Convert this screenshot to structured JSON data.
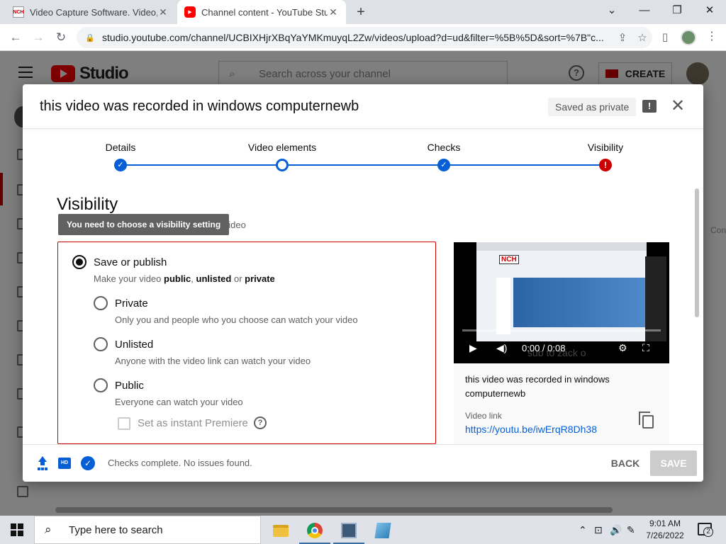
{
  "browser": {
    "tabs": [
      {
        "title": "Video Capture Software. Video, V",
        "favicon": "nch-icon",
        "active": false
      },
      {
        "title": "Channel content - YouTube Studi",
        "favicon": "youtube-icon",
        "active": true
      }
    ],
    "new_tab_glyph": "+",
    "window_controls": {
      "tab_search": "⌄",
      "minimize": "—",
      "restore": "❐",
      "close": "✕"
    },
    "nav": {
      "back": "←",
      "forward": "→",
      "reload": "↻"
    },
    "url": "studio.youtube.com/channel/UCBIXHjrXBqYaYMKmuyqL2Zw/videos/upload?d=ud&filter=%5B%5D&sort=%7B\"c...",
    "url_icons": {
      "share": "⇪",
      "bookmark": "☆"
    },
    "menu_dots": "⋮"
  },
  "studio": {
    "brand": "Studio",
    "search_placeholder": "Search across your channel",
    "help_glyph": "?",
    "create_label": "CREATE",
    "bg_cut_text": "Con"
  },
  "dialog": {
    "title": "this video was recorded in windows computernewb",
    "saved_status": "Saved as private",
    "feedback_glyph": "!",
    "close_glyph": "✕",
    "steps": [
      {
        "label": "Details",
        "state": "complete",
        "glyph": "✓"
      },
      {
        "label": "Video elements",
        "state": "current",
        "glyph": ""
      },
      {
        "label": "Checks",
        "state": "complete",
        "glyph": "✓"
      },
      {
        "label": "Visibility",
        "state": "error",
        "glyph": "!"
      }
    ],
    "visibility": {
      "heading": "Visibility",
      "description_tail": "e your video",
      "tooltip": "You need to choose a visibility setting",
      "save_or_publish": {
        "title": "Save or publish",
        "sub_prefix": "Make your video ",
        "sub_public": "public",
        "sub_comma": ", ",
        "sub_unlisted": "unlisted",
        "sub_or": " or ",
        "sub_private": "private"
      },
      "options": [
        {
          "title": "Private",
          "description": "Only you and people who you choose can watch your video"
        },
        {
          "title": "Unlisted",
          "description": "Anyone with the video link can watch your video"
        },
        {
          "title": "Public",
          "description": "Everyone can watch your video"
        }
      ],
      "premiere_label": "Set as instant Premiere",
      "premiere_help": "?"
    },
    "preview": {
      "time": "0:00 / 0:08",
      "overlay_text": "sub to zack o",
      "screenshot_logo": "NCH",
      "video_title": "this video was recorded in windows computernewb",
      "link_label": "Video link",
      "link_url": "https://youtu.be/iwErqR8Dh38"
    },
    "footer": {
      "hd_badge": "HD",
      "check_glyph": "✓",
      "status": "Checks complete. No issues found.",
      "back_label": "BACK",
      "save_label": "SAVE"
    }
  },
  "taskbar": {
    "search_placeholder": "Type here to search",
    "search_glyph": "⌕",
    "tray_up": "⌃",
    "tray_network": "⊡",
    "tray_volume": "🔊",
    "tray_pen": "✎",
    "time": "9:01 AM",
    "date": "7/26/2022",
    "notification_count": "2"
  }
}
